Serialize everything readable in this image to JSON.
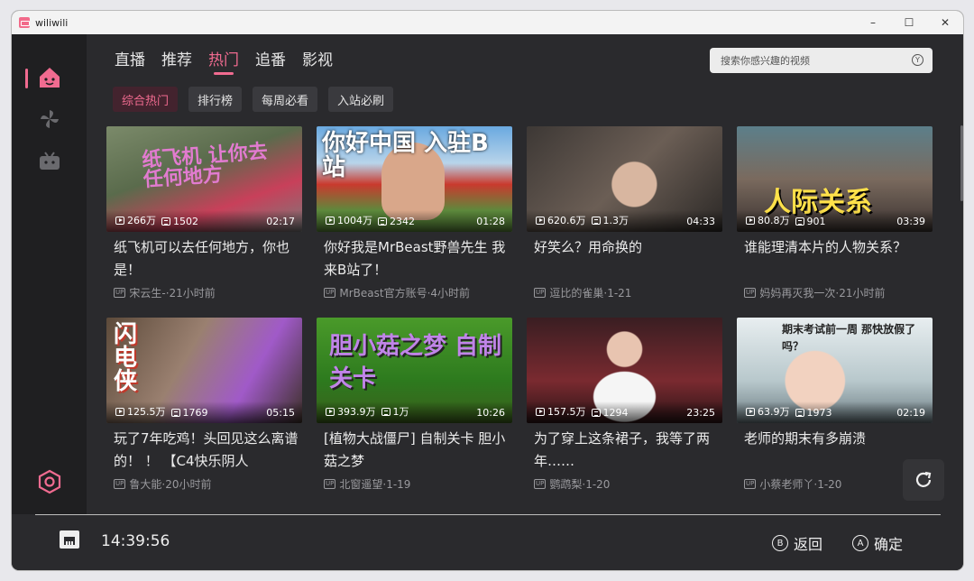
{
  "window": {
    "title": "wiliwili",
    "minimize": "–",
    "maximize": "☐",
    "close": "✕"
  },
  "tabs": [
    "直播",
    "推荐",
    "热门",
    "追番",
    "影视"
  ],
  "active_tab": 2,
  "search": {
    "placeholder": "搜索你感兴趣的视频",
    "key_hint": "Y"
  },
  "subtabs": [
    "综合热门",
    "排行榜",
    "每周必看",
    "入站必刷"
  ],
  "videos": [
    {
      "views": "266万",
      "danmaku": "1502",
      "duration": "02:17",
      "title": "纸飞机可以去任何地方，你也是！",
      "author": "宋云生-",
      "time": "21小时前",
      "overlay": "纸飞机 让你去任何地方"
    },
    {
      "views": "1004万",
      "danmaku": "2342",
      "duration": "01:28",
      "title": "你好我是MrBeast野兽先生 我来B站了！",
      "author": "MrBeast官方账号",
      "time": "4小时前",
      "overlay": "你好中国 入驻B站"
    },
    {
      "views": "620.6万",
      "danmaku": "1.3万",
      "duration": "04:33",
      "title": "好笑么？用命换的",
      "author": "逗比的雀巢",
      "time": "1-21",
      "overlay": ""
    },
    {
      "views": "80.8万",
      "danmaku": "901",
      "duration": "03:39",
      "title": "谁能理清本片的人物关系？",
      "author": "妈妈再灭我一次",
      "time": "21小时前",
      "overlay": "人际关系"
    },
    {
      "views": "125.5万",
      "danmaku": "1769",
      "duration": "05:15",
      "title": "玩了7年吃鸡！头回见这么离谱的！ ！ 【C4快乐阴人",
      "author": "鲁大能",
      "time": "20小时前",
      "overlay": "闪电侠"
    },
    {
      "views": "393.9万",
      "danmaku": "1万",
      "duration": "10:26",
      "title": "[植物大战僵尸] 自制关卡 胆小菇之梦",
      "author": "北窗遥望",
      "time": "1-19",
      "overlay": "胆小菇之梦 自制关卡"
    },
    {
      "views": "157.5万",
      "danmaku": "1294",
      "duration": "23:25",
      "title": "为了穿上这条裙子，我等了两年……",
      "author": "鹦鹉梨",
      "time": "1-20",
      "overlay": ""
    },
    {
      "views": "63.9万",
      "danmaku": "1973",
      "duration": "02:19",
      "title": "老师的期末有多崩溃",
      "author": "小蔡老师丫",
      "time": "1-20",
      "overlay": "期末考试前一周 那快放假了吗？"
    }
  ],
  "footer": {
    "time": "14:39:56",
    "back_key": "B",
    "back_label": "返回",
    "confirm_key": "A",
    "confirm_label": "确定"
  },
  "colors": {
    "accent": "#f06b90",
    "bg": "#2a2a2d",
    "sidebar": "#1f1f21"
  }
}
